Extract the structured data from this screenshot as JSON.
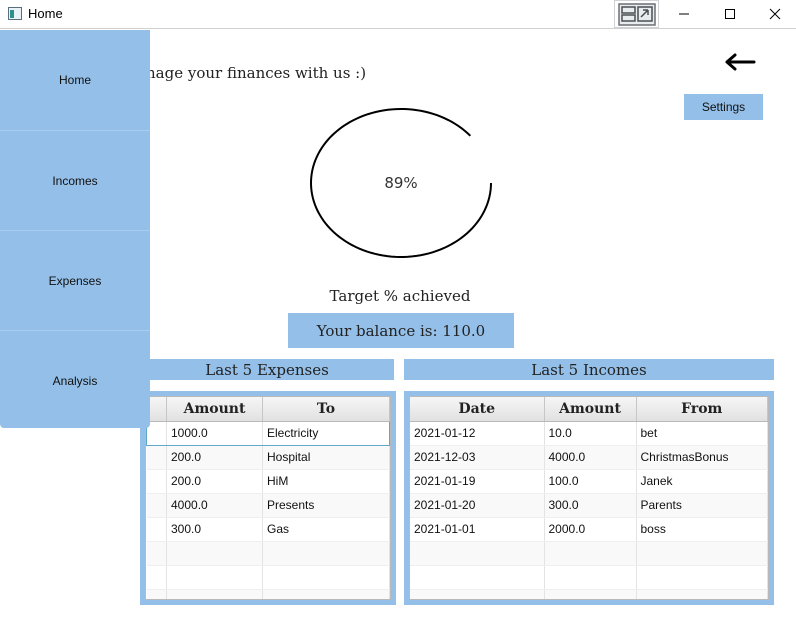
{
  "window": {
    "title": "Home"
  },
  "header": {
    "welcome": "nage your finances with us :)",
    "settings_label": "Settings"
  },
  "progress": {
    "value_percent": 89,
    "text": "89%"
  },
  "target": {
    "label": "Target % achieved"
  },
  "balance": {
    "text": "Your balance is: 110.0"
  },
  "sidebar": {
    "items": [
      {
        "label": "Home"
      },
      {
        "label": "Incomes"
      },
      {
        "label": "Expenses"
      },
      {
        "label": "Analysis"
      }
    ]
  },
  "expenses": {
    "title": "Last 5 Expenses",
    "columns": [
      "Amount",
      "To"
    ],
    "rows": [
      [
        "1000.0",
        "Electricity"
      ],
      [
        "200.0",
        "Hospital"
      ],
      [
        "200.0",
        "HiM"
      ],
      [
        "4000.0",
        "Presents"
      ],
      [
        "300.0",
        "Gas"
      ]
    ]
  },
  "incomes": {
    "title": "Last 5 Incomes",
    "columns": [
      "Date",
      "Amount",
      "From"
    ],
    "rows": [
      [
        "2021-01-12",
        "10.0",
        "bet"
      ],
      [
        "2021-12-03",
        "4000.0",
        "ChristmasBonus"
      ],
      [
        "2021-01-19",
        "100.0",
        "Janek"
      ],
      [
        "2021-01-20",
        "300.0",
        "Parents"
      ],
      [
        "2021-01-01",
        "2000.0",
        "boss"
      ]
    ]
  },
  "icons": {
    "app": "app-window-icon",
    "snap": "snap-layout-icon",
    "minimize": "minimize-icon",
    "maximize": "maximize-icon",
    "close": "close-icon",
    "back": "arrow-left-icon"
  },
  "colors": {
    "accent": "#94bfe8",
    "progress_stroke": "#000000",
    "selection": "#5fa8c8"
  }
}
